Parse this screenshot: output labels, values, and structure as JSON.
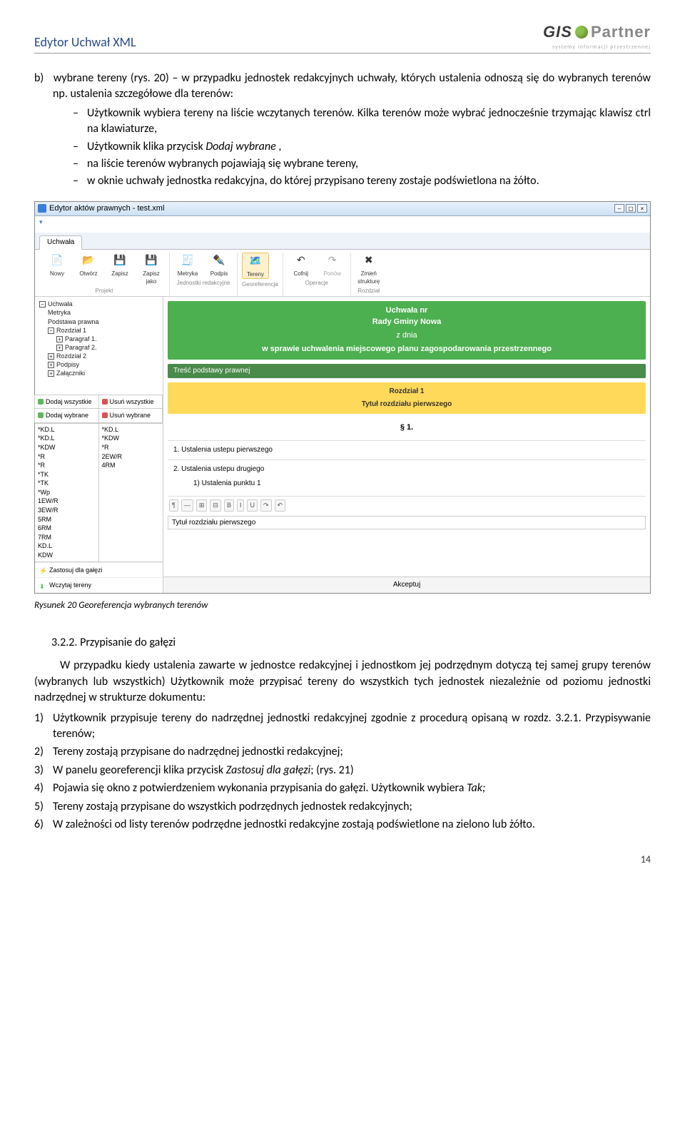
{
  "header": {
    "title": "Edytor Uchwał XML"
  },
  "logo": {
    "gis": "GIS",
    "partner": "Partner",
    "sub": "systemy   informacji   przestrzennej"
  },
  "para_b_lead": "wybrane tereny  (rys. 20) – w przypadku jednostek redakcyjnych uchwały, których ustalenia odnoszą się do wybranych  terenów np.  ustalenia szczegółowe dla terenów:",
  "para_b_label": "b)",
  "dashes": [
    "Użytkownik wybiera tereny na liście wczytanych terenów. Kilka terenów może wybrać jednocześnie trzymając klawisz ctrl na klawiaturze,",
    "Użytkownik klika przycisk <i>Dodaj wybrane</i> ,",
    "na liście terenów wybranych pojawiają się wybrane tereny,",
    "w oknie uchwały jednostka redakcyjna, do której  przypisano tereny zostaje podświetlona na żółto."
  ],
  "app": {
    "title": "Edytor aktów prawnych - test.xml",
    "tab": "Uchwała",
    "ribbon": {
      "groups": [
        {
          "label": "Projekt",
          "buttons": [
            {
              "name": "new",
              "label": "Nowy",
              "glyph": "📄"
            },
            {
              "name": "open",
              "label": "Otwórz",
              "glyph": "📂"
            },
            {
              "name": "save",
              "label": "Zapisz",
              "glyph": "💾"
            },
            {
              "name": "saveas",
              "label": "Zapisz jako",
              "glyph": "💾"
            }
          ]
        },
        {
          "label": "Jednostki redakcyjne",
          "buttons": [
            {
              "name": "metryka",
              "label": "Metryka",
              "glyph": "🧾"
            },
            {
              "name": "podpis",
              "label": "Podpis",
              "glyph": "✒️"
            }
          ]
        },
        {
          "label": "Georeferencja",
          "buttons": [
            {
              "name": "tereny",
              "label": "Tereny",
              "glyph": "🗺️",
              "selected": true
            }
          ]
        },
        {
          "label": "Operacje",
          "buttons": [
            {
              "name": "undo",
              "label": "Cofnij",
              "glyph": "↶"
            },
            {
              "name": "redo",
              "label": "Ponów",
              "glyph": "↷",
              "dim": true
            }
          ]
        },
        {
          "label": "Rozdział",
          "buttons": [
            {
              "name": "changestruct",
              "label": "Zmień strukturę",
              "glyph": "✖"
            }
          ]
        }
      ]
    },
    "tree": [
      {
        "t": "Uchwała",
        "box": "−",
        "lvl": 0
      },
      {
        "t": "Metryka",
        "lvl": 1
      },
      {
        "t": "Podstawa prawna",
        "lvl": 1
      },
      {
        "t": "Rozdział 1",
        "box": "−",
        "lvl": 1
      },
      {
        "t": "Paragraf 1.",
        "box": "+",
        "lvl": 2
      },
      {
        "t": "Paragraf 2.",
        "box": "+",
        "lvl": 2
      },
      {
        "t": "Rozdział 2",
        "box": "+",
        "lvl": 1
      },
      {
        "t": "Podpisy",
        "box": "+",
        "lvl": 1
      },
      {
        "t": "Załączniki",
        "box": "+",
        "lvl": 1
      }
    ],
    "teren_actions": [
      {
        "icon": "green",
        "label": "Dodaj wszystkie"
      },
      {
        "icon": "red",
        "label": "Usuń wszystkie"
      },
      {
        "icon": "green",
        "label": "Dodaj wybrane"
      },
      {
        "icon": "red",
        "label": "Usuń wybrane"
      }
    ],
    "teren_left": [
      "*KD.L",
      "*KD.L",
      "*KDW",
      "*R",
      "*R",
      "*TK",
      "*TK",
      "*Wp",
      "1EW/R",
      "3EW/R",
      "5RM",
      "6RM",
      "7RM",
      "KD.L",
      "KDW"
    ],
    "teren_right": [
      "*KD.L",
      "*KDW",
      "*R",
      "2EW/R",
      "4RM"
    ],
    "bottom_buttons": [
      {
        "icon": "⚡",
        "color": "#f0ad4e",
        "label": "Zastosuj dla gałęzi"
      },
      {
        "icon": "⬇",
        "color": "#5cb85c",
        "label": "Wczytaj tereny"
      }
    ],
    "greenhead": {
      "l1": "Uchwała nr",
      "l2": "Rady Gminy Nowa",
      "l3": "z dnia",
      "l4": "w sprawie uchwalenia miejscowego planu zagospodarowania przestrzennego"
    },
    "greenstrip": "Treść podstawy prawnej",
    "yellow": {
      "l1": "Rozdział 1",
      "l2": "Tytuł rozdziału pierwszego"
    },
    "section_sym": "§ 1.",
    "rows": [
      {
        "n": "1.",
        "t": "Ustalenia ustepu pierwszego"
      },
      {
        "n": "2.",
        "t": "Ustalenia ustepu drugiego",
        "sub": "1) Ustalenia punktu 1"
      }
    ],
    "editorbar": [
      "¶",
      "—",
      "⊞",
      "⊟",
      "B",
      "I",
      "U",
      "↷",
      "↶"
    ],
    "editor_placeholder": "Tytuł rozdziału pierwszego",
    "footer": "Akceptuj"
  },
  "caption": "Rysunek 20 Georeferencja wybranych terenów",
  "subsection": "3.2.2. Przypisanie do gałęzi",
  "para2": "W przypadku kiedy  ustalenia zawarte w jednostce redakcyjnej i jednostkom jej podrzędnym dotyczą tej samej grupy terenów (wybranych lub wszystkich) Użytkownik może przypisać  tereny do wszystkich  tych jednostek niezależnie od poziomu jednostki nadrzędnej w strukturze dokumentu:",
  "steps": [
    "Użytkownik  przypisuje tereny do nadrzędnej jednostki redakcyjnej  zgodnie z procedurą opisaną w rozdz.  3.2.1. Przypisywanie terenów;",
    "Tereny zostają przypisane do nadrzędnej jednostki redakcyjnej;",
    "W panelu georeferencji klika przycisk  <i>Zastosuj dla gałęzi</i>; (rys. 21)",
    "Pojawia się okno z potwierdzeniem wykonania przypisania do gałęzi.  Użytkownik wybiera <i>Tak;</i>",
    "Tereny zostają przypisane do wszystkich podrzędnych jednostek redakcyjnych;",
    "W zależności od listy terenów podrzędne jednostki redakcyjne zostają podświetlone na zielono lub żółto."
  ],
  "pagenum": "14"
}
